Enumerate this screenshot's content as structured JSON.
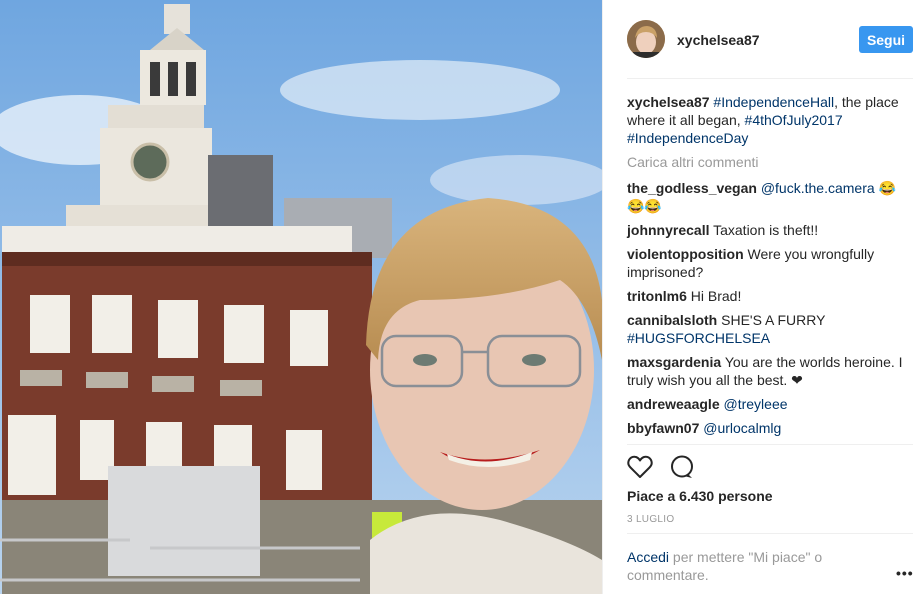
{
  "post": {
    "author": "xychelsea87",
    "follow_label": "Segui",
    "caption": {
      "user": "xychelsea87",
      "tag1": "#IndependenceHall",
      "text1": ", the place where it all began, ",
      "tag2": "#4thOfJuly2017",
      "tag3": "#IndependenceDay"
    },
    "load_more": "Carica altri commenti",
    "comments": [
      {
        "user": "the_godless_vegan",
        "tag": "@fuck.the.camera",
        "text": " 😂😂😂"
      },
      {
        "user": "johnnyrecall",
        "text": "Taxation is theft!!"
      },
      {
        "user": "violentopposition",
        "text": "Were you wrongfully imprisoned?"
      },
      {
        "user": "tritonlm6",
        "text": "Hi Brad!"
      },
      {
        "user": "cannibalsloth",
        "text": "SHE'S A FURRY ",
        "tag": "#HUGSFORCHELSEA"
      },
      {
        "user": "maxsgardenia",
        "text": "You are the worlds heroine. I truly wish you all the best. ❤"
      },
      {
        "user": "andreweaagle",
        "tag": "@treyleee"
      },
      {
        "user": "bbyfawn07",
        "tag": "@urlocalmlg"
      }
    ],
    "likes": "Piace a 6.430 persone",
    "date": "3 LUGLIO",
    "login_link": "Accedi",
    "login_text": " per mettere \"Mi piace\" o commentare.",
    "more_label": "•••"
  },
  "icons": [
    "heart-icon",
    "comment-icon",
    "more-options-icon"
  ]
}
